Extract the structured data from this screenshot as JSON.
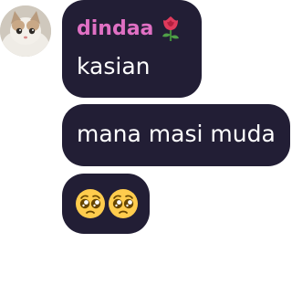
{
  "chat": {
    "sender": {
      "name": "dindaa",
      "name_color": "#e070c4",
      "badge_icon": "rose-emoji",
      "avatar": "cat-avatar"
    },
    "messages": [
      {
        "text": "kasian"
      },
      {
        "text": "mana masi muda"
      },
      {
        "emojis": [
          "pleading-face-emoji",
          "pleading-face-emoji"
        ]
      }
    ],
    "bubble_color": "#221e35",
    "text_color": "#ffffff"
  }
}
